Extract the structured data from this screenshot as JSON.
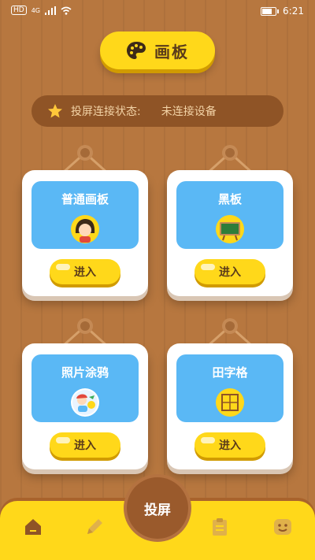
{
  "statusbar": {
    "left_text": "HD",
    "signal_text": "4G",
    "time": "6:21"
  },
  "title": {
    "icon": "palette-icon",
    "text": "画板"
  },
  "connection": {
    "label": "投屏连接状态:",
    "value": "未连接设备",
    "icon": "star-icon"
  },
  "cards": [
    {
      "label": "普通画板",
      "button": "进入",
      "icon": "girl-avatar-icon"
    },
    {
      "label": "黑板",
      "button": "进入",
      "icon": "chalkboard-icon"
    },
    {
      "label": "照片涂鸦",
      "button": "进入",
      "icon": "photo-doodle-icon"
    },
    {
      "label": "田字格",
      "button": "进入",
      "icon": "grid-icon"
    }
  ],
  "bottom": {
    "cast_label": "投屏",
    "nav": [
      "home-icon",
      "pencil-icon",
      "clipboard-icon",
      "smile-icon"
    ]
  },
  "colors": {
    "background": "#b7773f",
    "accent_yellow": "#ffd81a",
    "panel_blue": "#5ab8f5",
    "dark_brown": "#8f5426"
  }
}
